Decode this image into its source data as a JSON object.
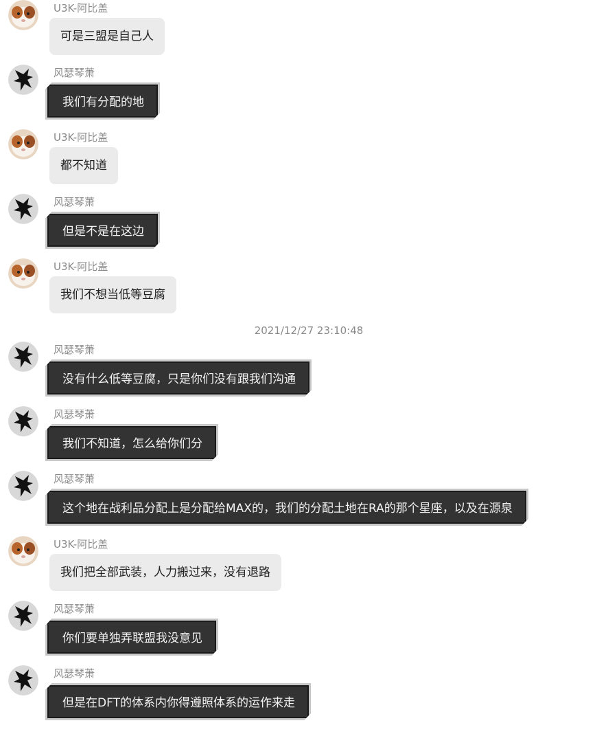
{
  "users": {
    "u3k": {
      "name": "U3K-阿比盖"
    },
    "fs": {
      "name": "风瑟琴萧"
    }
  },
  "messages": [
    {
      "sender": "U3K-阿比盖",
      "text": "可是三盟是自己人"
    },
    {
      "sender": "风瑟琴萧",
      "text": "我们有分配的地"
    },
    {
      "sender": "U3K-阿比盖",
      "text": "都不知道"
    },
    {
      "sender": "风瑟琴萧",
      "text": "但是不是在这边"
    },
    {
      "sender": "U3K-阿比盖",
      "text": "我们不想当低等豆腐"
    },
    {
      "sender": "风瑟琴萧",
      "text": "没有什么低等豆腐，只是你们没有跟我们沟通"
    },
    {
      "sender": "风瑟琴萧",
      "text": "我们不知道，怎么给你们分"
    },
    {
      "sender": "风瑟琴萧",
      "text": "这个地在战利品分配上是分配给MAX的，我们的分配土地在RA的那个星座，以及在源泉"
    },
    {
      "sender": "U3K-阿比盖",
      "text": "我们把全部武装，人力搬过来，没有退路"
    },
    {
      "sender": "风瑟琴萧",
      "text": "你们要单独弄联盟我没意见"
    },
    {
      "sender": "风瑟琴萧",
      "text": "但是在DFT的体系内你得遵照体系的运作来走"
    }
  ],
  "timestamp": "2021/12/27 23:10:48",
  "icons": {
    "u3k_avatar": "guinea-pig-avatar-icon",
    "fs_avatar": "dragon-avatar-icon"
  }
}
